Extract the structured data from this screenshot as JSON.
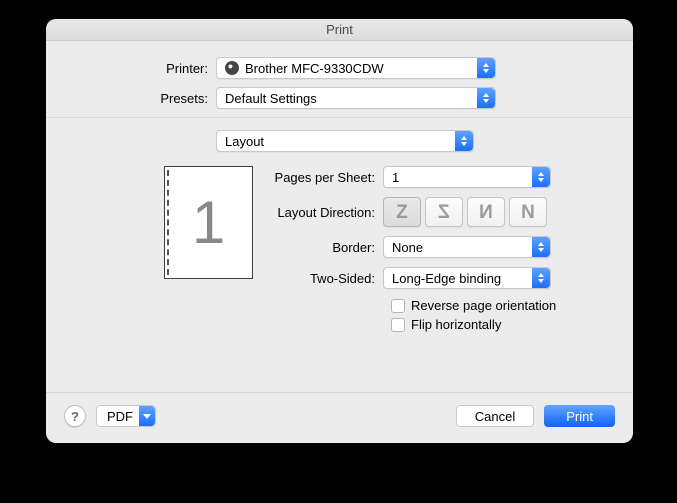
{
  "title": "Print",
  "labels": {
    "printer": "Printer:",
    "presets": "Presets:",
    "pages_per_sheet": "Pages per Sheet:",
    "layout_direction": "Layout Direction:",
    "border": "Border:",
    "two_sided": "Two-Sided:"
  },
  "values": {
    "printer": "Brother MFC-9330CDW",
    "presets": "Default Settings",
    "section": "Layout",
    "pages_per_sheet": "1",
    "border": "None",
    "two_sided": "Long-Edge binding"
  },
  "checkboxes": {
    "reverse": "Reverse page orientation",
    "flip": "Flip horizontally"
  },
  "preview": {
    "page_number": "1"
  },
  "footer": {
    "help": "?",
    "pdf": "PDF",
    "cancel": "Cancel",
    "print": "Print"
  }
}
